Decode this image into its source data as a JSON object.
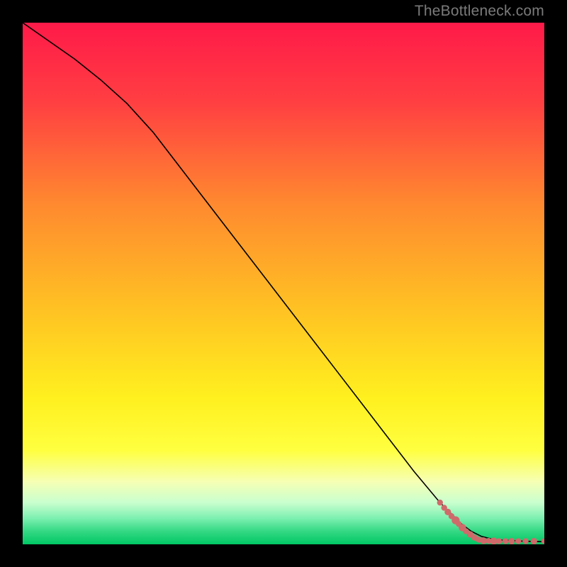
{
  "watermark": "TheBottleneck.com",
  "chart_data": {
    "type": "line",
    "title": "",
    "xlabel": "",
    "ylabel": "",
    "xlim": [
      0,
      100
    ],
    "ylim": [
      0,
      100
    ],
    "background_gradient": {
      "stops": [
        {
          "pct": 0.0,
          "color": "#ff1a49"
        },
        {
          "pct": 0.15,
          "color": "#ff3e42"
        },
        {
          "pct": 0.35,
          "color": "#ff8a2f"
        },
        {
          "pct": 0.55,
          "color": "#ffc223"
        },
        {
          "pct": 0.72,
          "color": "#fff01f"
        },
        {
          "pct": 0.82,
          "color": "#ffff40"
        },
        {
          "pct": 0.88,
          "color": "#f6ffb4"
        },
        {
          "pct": 0.92,
          "color": "#c9ffcf"
        },
        {
          "pct": 0.95,
          "color": "#7cf0b0"
        },
        {
          "pct": 0.975,
          "color": "#34d884"
        },
        {
          "pct": 1.0,
          "color": "#00c864"
        }
      ]
    },
    "series": [
      {
        "name": "curve",
        "type": "line",
        "color": "#000000",
        "x": [
          0,
          5,
          10,
          15,
          20,
          25,
          30,
          35,
          40,
          45,
          50,
          55,
          60,
          65,
          70,
          75,
          80,
          82,
          84,
          86,
          88,
          90,
          92,
          94,
          96,
          98,
          100
        ],
        "y": [
          100,
          96.5,
          93,
          89,
          84.5,
          79,
          72.5,
          66,
          59.5,
          53,
          46.5,
          40,
          33.5,
          27,
          20.5,
          14,
          8,
          6,
          4,
          2.5,
          1.5,
          1,
          0.8,
          0.7,
          0.6,
          0.55,
          0.5
        ]
      },
      {
        "name": "points",
        "type": "scatter",
        "color": "#cf6a6a",
        "radius_default": 4.2,
        "points": [
          {
            "x": 80.0,
            "y": 8.0,
            "r": 4.2
          },
          {
            "x": 80.8,
            "y": 7.0,
            "r": 4.2
          },
          {
            "x": 81.5,
            "y": 6.2,
            "r": 4.6
          },
          {
            "x": 82.2,
            "y": 5.4,
            "r": 4.2
          },
          {
            "x": 83.0,
            "y": 4.6,
            "r": 5.6
          },
          {
            "x": 83.6,
            "y": 3.9,
            "r": 4.2
          },
          {
            "x": 84.3,
            "y": 3.2,
            "r": 5.2
          },
          {
            "x": 85.0,
            "y": 2.5,
            "r": 4.2
          },
          {
            "x": 85.8,
            "y": 1.9,
            "r": 4.6
          },
          {
            "x": 86.6,
            "y": 1.3,
            "r": 4.4
          },
          {
            "x": 87.4,
            "y": 0.9,
            "r": 4.2
          },
          {
            "x": 88.3,
            "y": 0.7,
            "r": 4.8
          },
          {
            "x": 89.3,
            "y": 0.65,
            "r": 4.2
          },
          {
            "x": 90.3,
            "y": 0.6,
            "r": 5.2
          },
          {
            "x": 91.3,
            "y": 0.6,
            "r": 4.2
          },
          {
            "x": 92.5,
            "y": 0.6,
            "r": 4.2
          },
          {
            "x": 93.7,
            "y": 0.6,
            "r": 4.6
          },
          {
            "x": 95.0,
            "y": 0.6,
            "r": 4.2
          },
          {
            "x": 96.4,
            "y": 0.6,
            "r": 4.2
          },
          {
            "x": 98.0,
            "y": 0.6,
            "r": 4.6
          },
          {
            "x": 100.0,
            "y": 0.6,
            "r": 4.2
          }
        ]
      }
    ]
  }
}
